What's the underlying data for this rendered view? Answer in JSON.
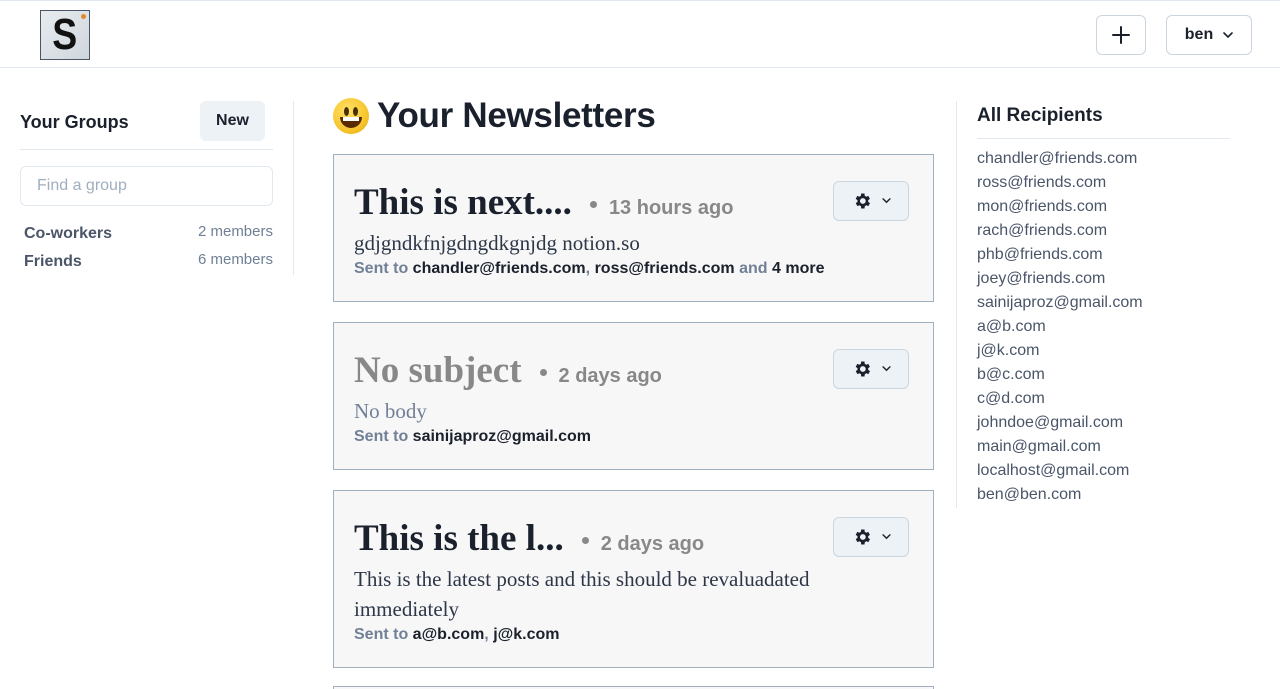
{
  "header": {
    "logo_letter": "S",
    "add_label": "+",
    "user_label": "ben"
  },
  "sidebar": {
    "title": "Your Groups",
    "new_label": "New",
    "search_placeholder": "Find a group",
    "groups": [
      {
        "name": "Co-workers",
        "count": "2 members"
      },
      {
        "name": "Friends",
        "count": "6 members"
      }
    ]
  },
  "main": {
    "title": "Your Newsletters",
    "sent_to_label": "Sent to",
    "newsletters": [
      {
        "title": "This is next....",
        "time": "13 hours ago",
        "body": "gdjgndkfnjgdngdkgnjdg notion.so",
        "recipients": [
          "chandler@friends.com",
          "ross@friends.com"
        ],
        "and_label": "and",
        "more_label": "4 more"
      },
      {
        "title": "No subject",
        "time": "2 days ago",
        "body": "No body",
        "recipients": [
          "sainijaproz@gmail.com"
        ]
      },
      {
        "title": "This is the l...",
        "time": "2 days ago",
        "body": "This is the latest posts and this should be revaluadated immediately",
        "recipients": [
          "a@b.com",
          "j@k.com"
        ]
      }
    ]
  },
  "recipients": {
    "title": "All Recipients",
    "items": [
      "chandler@friends.com",
      "ross@friends.com",
      "mon@friends.com",
      "rach@friends.com",
      "phb@friends.com",
      "joey@friends.com",
      "sainijaproz@gmail.com",
      "a@b.com",
      "j@k.com",
      "b@c.com",
      "c@d.com",
      "johndoe@gmail.com",
      "main@gmail.com",
      "localhost@gmail.com",
      "ben@ben.com"
    ]
  },
  "colors": {
    "text": "#1a202c",
    "muted": "#718096",
    "card_bg": "#f7f7f7",
    "button_bg": "#edf2f7"
  }
}
